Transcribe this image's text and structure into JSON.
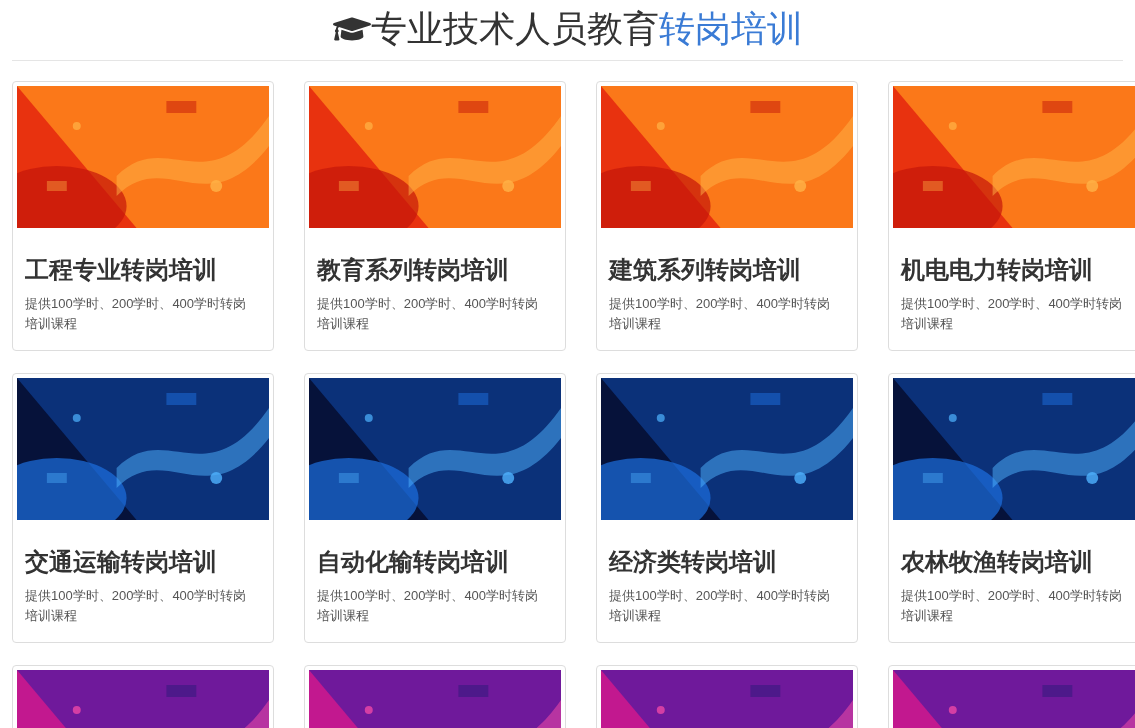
{
  "header": {
    "title": "专业技术人员教育",
    "highlight": "转岗培训"
  },
  "rows": [
    {
      "cards": [
        {
          "kind": "course",
          "title": "工程专业转岗培训",
          "description": "提供100学时、200学时、400学时转岗培训课程"
        },
        {
          "kind": "course",
          "title": "教育系列转岗培训",
          "description": "提供100学时、200学时、400学时转岗培训课程"
        },
        {
          "kind": "course",
          "title": "建筑系列转岗培训",
          "description": "提供100学时、200学时、400学时转岗培训课程"
        },
        {
          "kind": "course",
          "title": "机电电力转岗培训",
          "description": "提供100学时、200学时、400学时转岗培训课程"
        }
      ]
    },
    {
      "cards": [
        {
          "kind": "course",
          "title": "交通运输转岗培训",
          "description": "提供100学时、200学时、400学时转岗培训课程"
        },
        {
          "kind": "course",
          "title": "自动化输转岗培训",
          "description": "提供100学时、200学时、400学时转岗培训课程"
        },
        {
          "kind": "course",
          "title": "经济类转岗培训",
          "description": "提供100学时、200学时、400学时转岗培训课程"
        },
        {
          "kind": "course",
          "title": "农林牧渔转岗培训",
          "description": "提供100学时、200学时、400学时转岗培训课程"
        }
      ]
    },
    {
      "cards": [
        {
          "kind": "banner"
        },
        {
          "kind": "banner"
        },
        {
          "kind": "banner"
        },
        {
          "kind": "banner"
        }
      ]
    }
  ]
}
